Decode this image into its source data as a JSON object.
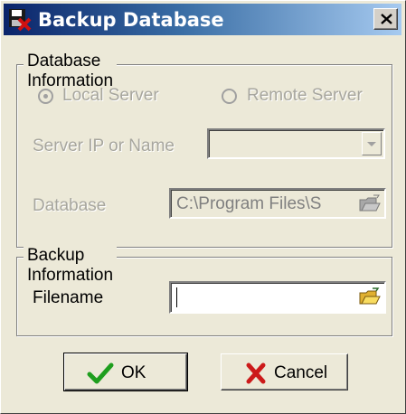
{
  "window": {
    "title": "Backup Database",
    "close_symbol": "×"
  },
  "database_info": {
    "legend": "Database Information",
    "local_server_label": "Local Server",
    "remote_server_label": "Remote Server",
    "selected": "Local Server",
    "server_label": "Server IP or Name",
    "server_value": "",
    "database_label": "Database",
    "database_value": "C:\\Program Files\\S"
  },
  "backup_info": {
    "legend": "Backup Information",
    "filename_label": "Filename",
    "filename_value": ""
  },
  "buttons": {
    "ok_label": "OK",
    "cancel_label": "Cancel"
  },
  "icons": {
    "title": "database-backup-icon",
    "dropdown": "chevron-down-icon",
    "browse": "folder-open-icon",
    "ok": "checkmark-icon",
    "cancel": "x-mark-icon"
  },
  "colors": {
    "titlebar_start": "#0a246a",
    "titlebar_end": "#a6caf0",
    "ok_check": "#1e9e1e",
    "cancel_x": "#cc1a1a"
  }
}
